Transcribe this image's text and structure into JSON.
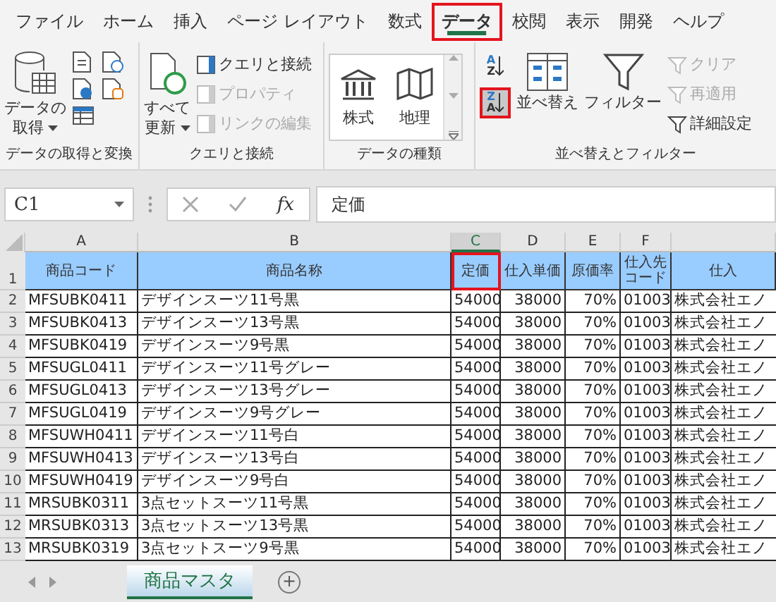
{
  "ribbon_tabs": [
    {
      "label": "ファイル",
      "selected": false,
      "highlighted": false
    },
    {
      "label": "ホーム",
      "selected": false,
      "highlighted": false
    },
    {
      "label": "挿入",
      "selected": false,
      "highlighted": false
    },
    {
      "label": "ページ レイアウト",
      "selected": false,
      "highlighted": false
    },
    {
      "label": "数式",
      "selected": false,
      "highlighted": false
    },
    {
      "label": "データ",
      "selected": true,
      "highlighted": true
    },
    {
      "label": "校閲",
      "selected": false,
      "highlighted": false
    },
    {
      "label": "表示",
      "selected": false,
      "highlighted": false
    },
    {
      "label": "開発",
      "selected": false,
      "highlighted": false
    },
    {
      "label": "ヘルプ",
      "selected": false,
      "highlighted": false
    }
  ],
  "groups": [
    {
      "label": "データの取得と変換",
      "large": [
        "データの",
        "取得"
      ]
    },
    {
      "label": "クエリと接続",
      "large": [
        "すべて",
        "更新"
      ],
      "small": [
        {
          "label": "クエリと接続",
          "disabled": false
        },
        {
          "label": "プロパティ",
          "disabled": true
        },
        {
          "label": "リンクの編集",
          "disabled": true
        }
      ]
    },
    {
      "label": "データの種類",
      "gallery": [
        "株式",
        "地理"
      ]
    },
    {
      "label": "並べ替えとフィルター",
      "sort_buttons": [
        {
          "top": "A",
          "bottom": "Z",
          "highlighted": false
        },
        {
          "top": "Z",
          "bottom": "A",
          "highlighted": true
        }
      ],
      "sort": "並べ替え",
      "filter": "フィルター",
      "small": [
        {
          "label": "クリア",
          "disabled": true
        },
        {
          "label": "再適用",
          "disabled": true
        },
        {
          "label": "詳細設定",
          "disabled": false
        }
      ]
    }
  ],
  "formula_bar": {
    "name_box": "C1",
    "function_label": "fx",
    "formula": "定価"
  },
  "columns": [
    {
      "letter": "A",
      "selected": false
    },
    {
      "letter": "B",
      "selected": false
    },
    {
      "letter": "C",
      "selected": true
    },
    {
      "letter": "D",
      "selected": false
    },
    {
      "letter": "E",
      "selected": false
    },
    {
      "letter": "F",
      "selected": false
    }
  ],
  "header_row": {
    "number": "1",
    "cells": [
      {
        "text": "商品コード",
        "highlighted": false
      },
      {
        "text": "商品名称",
        "highlighted": false
      },
      {
        "text": "定価",
        "highlighted": true
      },
      {
        "text": "仕入単価",
        "highlighted": false
      },
      {
        "text": "原価率",
        "highlighted": false
      },
      {
        "text": "仕入先コード",
        "highlighted": false
      },
      {
        "text": "仕入",
        "highlighted": false
      }
    ]
  },
  "rows": [
    {
      "number": "2",
      "cells": [
        "MFSUBK0411",
        "デザインスーツ11号黒",
        "54000",
        "38000",
        "70%",
        "01003",
        "株式会社エノ"
      ]
    },
    {
      "number": "3",
      "cells": [
        "MFSUBK0413",
        "デザインスーツ13号黒",
        "54000",
        "38000",
        "70%",
        "01003",
        "株式会社エノ"
      ]
    },
    {
      "number": "4",
      "cells": [
        "MFSUBK0419",
        "デザインスーツ9号黒",
        "54000",
        "38000",
        "70%",
        "01003",
        "株式会社エノ"
      ]
    },
    {
      "number": "5",
      "cells": [
        "MFSUGL0411",
        "デザインスーツ11号グレー",
        "54000",
        "38000",
        "70%",
        "01003",
        "株式会社エノ"
      ]
    },
    {
      "number": "6",
      "cells": [
        "MFSUGL0413",
        "デザインスーツ13号グレー",
        "54000",
        "38000",
        "70%",
        "01003",
        "株式会社エノ"
      ]
    },
    {
      "number": "7",
      "cells": [
        "MFSUGL0419",
        "デザインスーツ9号グレー",
        "54000",
        "38000",
        "70%",
        "01003",
        "株式会社エノ"
      ]
    },
    {
      "number": "8",
      "cells": [
        "MFSUWH0411",
        "デザインスーツ11号白",
        "54000",
        "38000",
        "70%",
        "01003",
        "株式会社エノ"
      ]
    },
    {
      "number": "9",
      "cells": [
        "MFSUWH0413",
        "デザインスーツ13号白",
        "54000",
        "38000",
        "70%",
        "01003",
        "株式会社エノ"
      ]
    },
    {
      "number": "10",
      "cells": [
        "MFSUWH0419",
        "デザインスーツ9号白",
        "54000",
        "38000",
        "70%",
        "01003",
        "株式会社エノ"
      ]
    },
    {
      "number": "11",
      "cells": [
        "MRSUBK0311",
        "3点セットスーツ11号黒",
        "54000",
        "38000",
        "70%",
        "01003",
        "株式会社エノ"
      ]
    },
    {
      "number": "12",
      "cells": [
        "MRSUBK0313",
        "3点セットスーツ13号黒",
        "54000",
        "38000",
        "70%",
        "01003",
        "株式会社エノ"
      ]
    },
    {
      "number": "13",
      "cells": [
        "MRSUBK0319",
        "3点セットスーツ9号黒",
        "54000",
        "38000",
        "70%",
        "01003",
        "株式会社エノ"
      ]
    }
  ],
  "sheet_tabs": [
    {
      "label": "商品マスタ",
      "selected": true
    }
  ],
  "new_sheet": "+"
}
